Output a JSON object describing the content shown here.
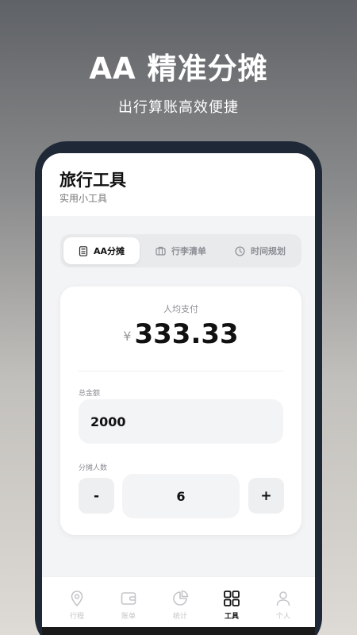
{
  "promo": {
    "title": "AA 精准分摊",
    "subtitle": "出行算账高效便捷"
  },
  "app": {
    "title": "旅行工具",
    "subtitle": "实用小工具"
  },
  "tabs": [
    {
      "label": "AA分摊",
      "icon": "calculator-icon",
      "active": true
    },
    {
      "label": "行李清单",
      "icon": "briefcase-icon",
      "active": false
    },
    {
      "label": "时间规划",
      "icon": "clock-icon",
      "active": false
    }
  ],
  "calculator": {
    "per_person_label": "人均支付",
    "currency_symbol": "¥",
    "per_person_value": "333.33",
    "total_label": "总金额",
    "total_value": "2000",
    "people_label": "分摊人数",
    "people_count": "6",
    "decrement_label": "-",
    "increment_label": "+"
  },
  "nav": [
    {
      "label": "行程",
      "icon": "location-pin-icon",
      "active": false
    },
    {
      "label": "账单",
      "icon": "wallet-icon",
      "active": false
    },
    {
      "label": "统计",
      "icon": "pie-chart-icon",
      "active": false
    },
    {
      "label": "工具",
      "icon": "grid-icon",
      "active": true
    },
    {
      "label": "个人",
      "icon": "person-icon",
      "active": false
    }
  ],
  "colors": {
    "accent": "#111111",
    "inactive": "#c3c5c9",
    "phone_frame": "#1f2837"
  }
}
